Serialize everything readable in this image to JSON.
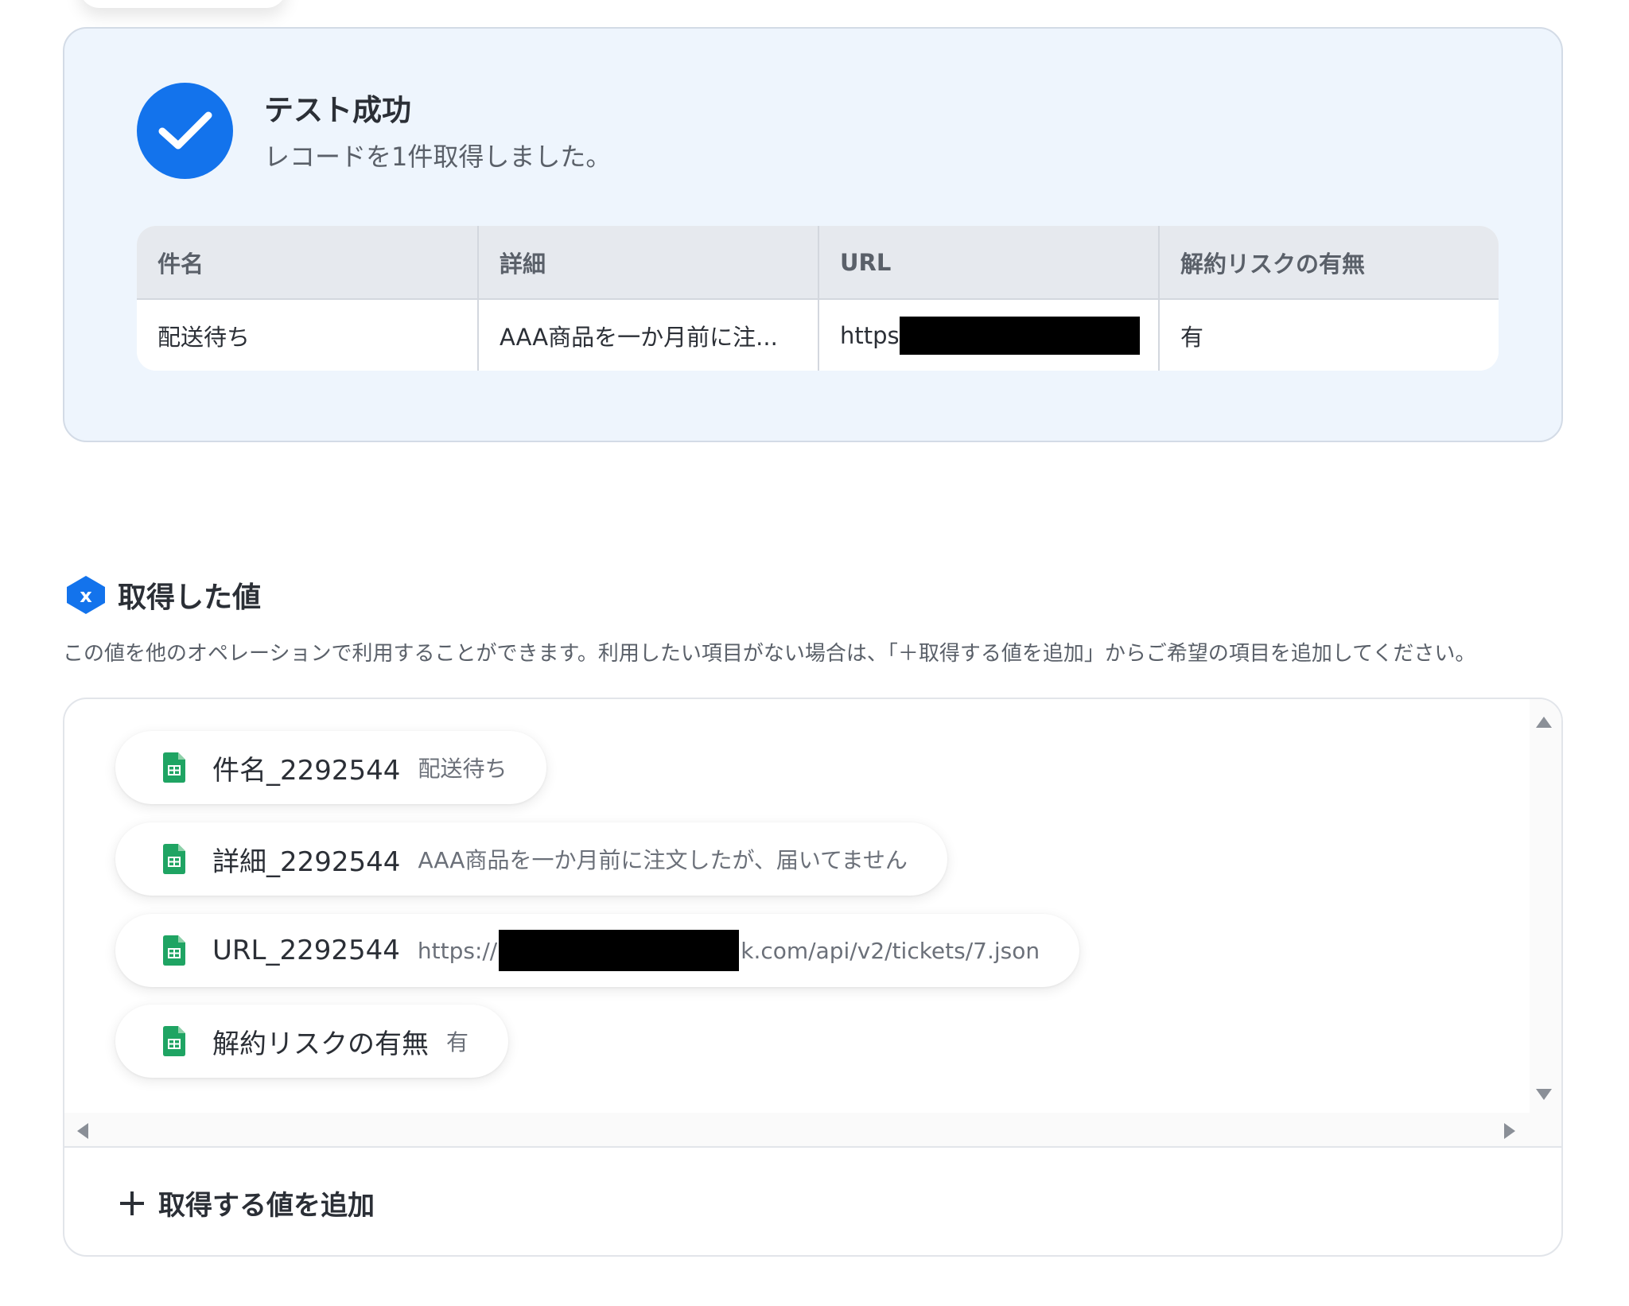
{
  "success": {
    "title": "テスト成功",
    "subtitle": "レコードを1件取得しました。",
    "columns": [
      "件名",
      "詳細",
      "URL",
      "解約リスクの有無"
    ],
    "row": [
      "配送待ち",
      "AAA商品を一か月前に注...",
      "https",
      "有"
    ],
    "accent_color": "#1373ec"
  },
  "values": {
    "title": "取得した値",
    "description": "この値を他のオペレーションで利用することができます。利用したい項目がない場合は、「＋取得する値を追加」からご希望の項目を追加してください。",
    "chips": [
      {
        "label": "件名_2292544",
        "value": "配送待ち"
      },
      {
        "label": "詳細_2292544",
        "value": "AAA商品を一か月前に注文したが、届いてません"
      },
      {
        "label": "URL_2292544",
        "value_prefix": "https://",
        "value_suffix": "k.com/api/v2/tickets/7.json"
      },
      {
        "label": "解約リスクの有無",
        "value": "有"
      }
    ],
    "add_label": "取得する値を追加",
    "icon": "spreadsheet-icon",
    "sheet_color": "#1fa463"
  }
}
